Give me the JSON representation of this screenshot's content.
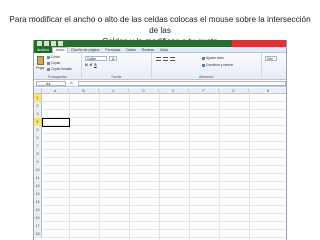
{
  "caption": {
    "line1": "Para modificar el ancho o alto de las celdas colocas el mouse sobre la intersección de las",
    "line2": "Celdas y lo modificas a tu gusto"
  },
  "ribbon": {
    "tabs": [
      "Archivo",
      "Inicio",
      "Diseño de página",
      "Fórmulas",
      "Datos",
      "Revisar",
      "Vista"
    ],
    "clipboard": {
      "paste": "Pegar",
      "cut": "Cortar",
      "copy": "Copiar",
      "format": "Copiar formato",
      "label": "Portapapeles"
    },
    "font": {
      "name": "Calibri",
      "size": "11",
      "bold": "N",
      "italic": "K",
      "underline": "S",
      "label": "Fuente"
    },
    "alignment": {
      "wrap": "Ajustar texto",
      "merge": "Combinar y centrar",
      "label": "Alineación"
    },
    "number": {
      "format": "Gen"
    }
  },
  "formula_bar": {
    "namebox": "A4",
    "fx": "fx"
  },
  "grid": {
    "columns": [
      "A",
      "B",
      "C",
      "D",
      "E",
      "F",
      "G",
      "H"
    ],
    "rows": [
      "1",
      "2",
      "3",
      "4",
      "5",
      "6",
      "7",
      "8",
      "9",
      "10",
      "11",
      "12",
      "13",
      "14",
      "15",
      "16",
      "17",
      "18"
    ],
    "selected_cell": "A4",
    "highlight_row_color": "#f6e27a"
  },
  "colors": {
    "excel_green": "#2e6a2f",
    "file_tab": "#1f6b2a",
    "title_red": "#d93535"
  }
}
